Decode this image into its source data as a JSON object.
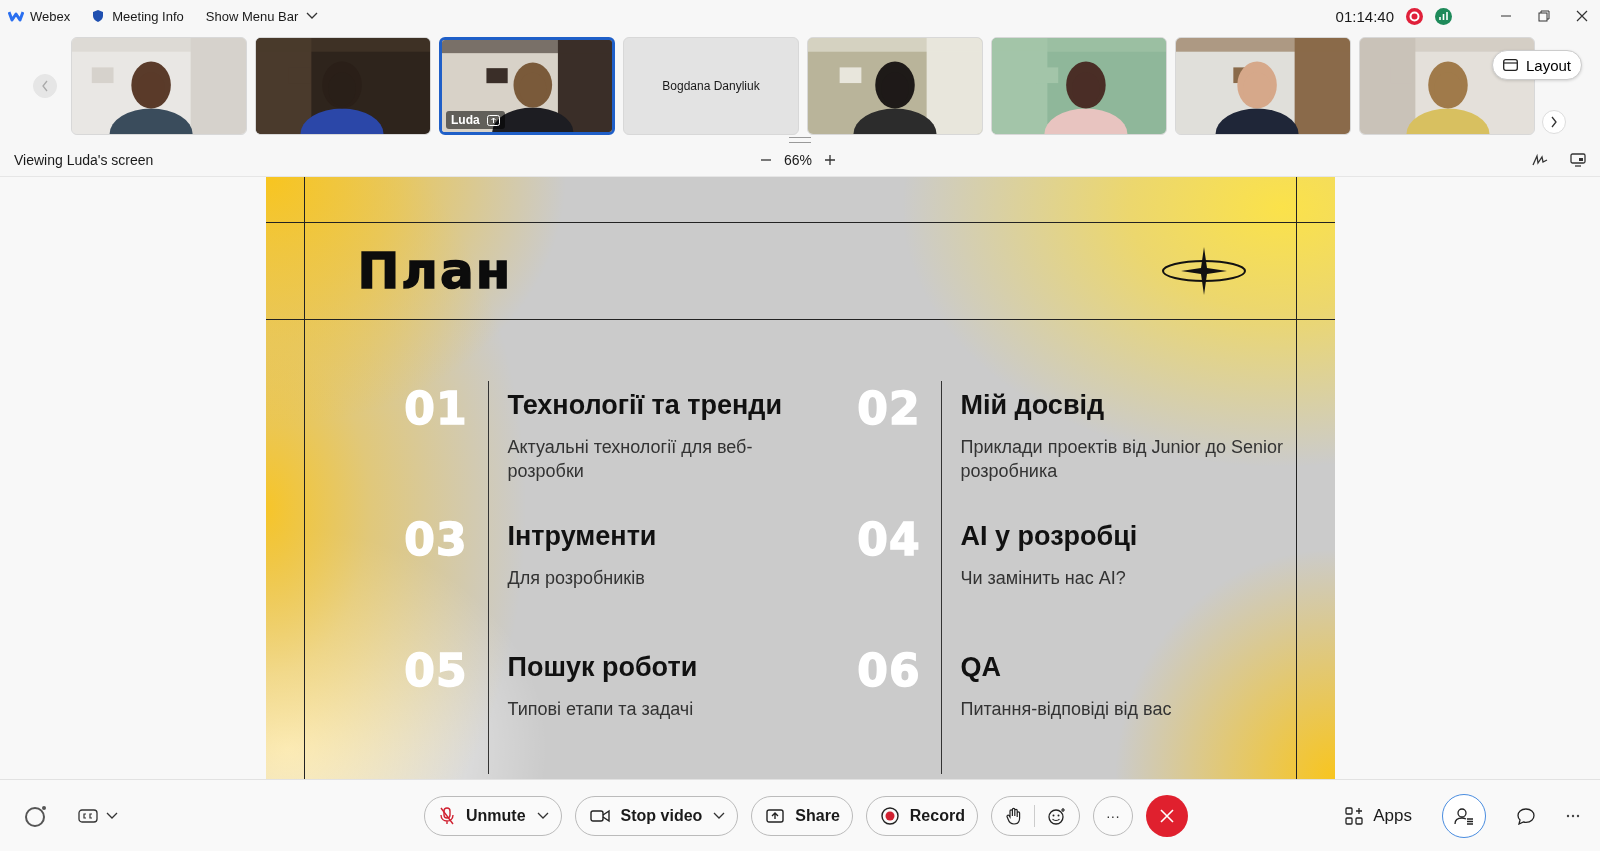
{
  "title_bar": {
    "app_name": "Webex",
    "meeting_info": "Meeting Info",
    "menu_bar": "Show Menu Bar",
    "timer": "01:14:40"
  },
  "participants": [
    {
      "kind": "video",
      "selected": false
    },
    {
      "kind": "video",
      "selected": false
    },
    {
      "kind": "video",
      "name": "Luda",
      "sharing": true,
      "selected": true
    },
    {
      "kind": "name",
      "name": "Bogdana Danyliuk",
      "selected": false
    },
    {
      "kind": "video",
      "selected": false
    },
    {
      "kind": "video",
      "selected": false
    },
    {
      "kind": "video",
      "selected": false
    },
    {
      "kind": "video",
      "selected": false
    }
  ],
  "layout_button": "Layout",
  "view_bar": {
    "label": "Viewing Luda's screen",
    "zoom": "66%"
  },
  "slide": {
    "title": "План",
    "items": [
      {
        "number": "01",
        "title": "Технології та тренди",
        "description": "Актуальні технології для веб-розробки"
      },
      {
        "number": "02",
        "title": "Мій досвід",
        "description": "Приклади проектів від Junior до Senior розробника"
      },
      {
        "number": "03",
        "title": "Інтрументи",
        "description": "Для розробників"
      },
      {
        "number": "04",
        "title": "AI у розробці",
        "description": "Чи замінить нас AI?"
      },
      {
        "number": "05",
        "title": "Пошук роботи",
        "description": "Типові етапи та задачі"
      },
      {
        "number": "06",
        "title": "QA",
        "description": "Питання-відповіді від вас"
      }
    ]
  },
  "controls": {
    "unmute": "Unmute",
    "stop_video": "Stop video",
    "share": "Share",
    "record": "Record",
    "more": "···",
    "apps": "Apps"
  }
}
